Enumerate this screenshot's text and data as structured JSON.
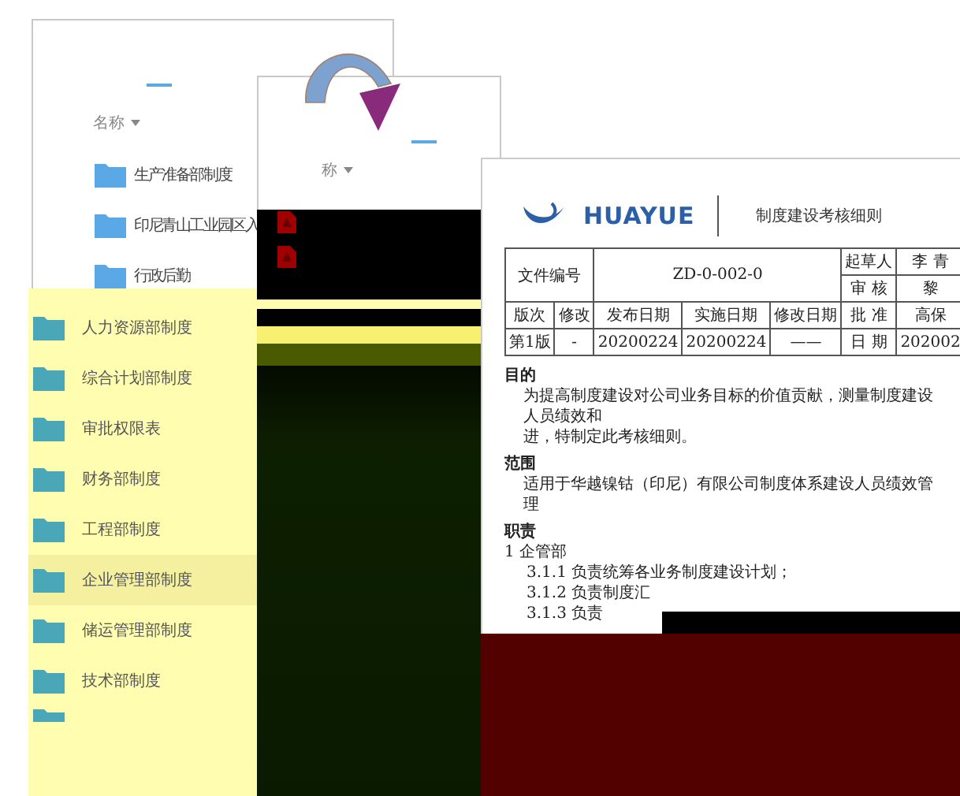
{
  "back_explorer": {
    "column_header": "名称",
    "items": [
      "生产准备部制度",
      "印尼青山工业园区入",
      "行政后勤"
    ]
  },
  "middle_explorer": {
    "column_header": "称"
  },
  "folder_panel": {
    "items": [
      {
        "name": "人力资源部制度",
        "selected": false
      },
      {
        "name": "综合计划部制度",
        "selected": false
      },
      {
        "name": "审批权限表",
        "selected": false
      },
      {
        "name": "财务部制度",
        "selected": false
      },
      {
        "name": "工程部制度",
        "selected": false
      },
      {
        "name": "企业管理部制度",
        "selected": true
      },
      {
        "name": "储运管理部制度",
        "selected": false
      },
      {
        "name": "技术部制度",
        "selected": false
      }
    ]
  },
  "document": {
    "logo": "HUAYUE",
    "title": "制度建设考核细则",
    "header_table": {
      "doc_no_label": "文件编号",
      "doc_no": "ZD-0-002-0",
      "drafter_label": "起草人",
      "drafter": "李 青",
      "reviewer_label": "审 核",
      "reviewer": "黎",
      "columns": [
        "版次",
        "修改",
        "发布日期",
        "实施日期",
        "修改日期"
      ],
      "approver_label": "批 准",
      "approver": "高保",
      "row": [
        "第1版",
        "-",
        "20200224",
        "20200224",
        "——"
      ],
      "date_label": "日 期",
      "date": "202002"
    },
    "sections": [
      {
        "kind": "heading",
        "text": "目的"
      },
      {
        "kind": "para",
        "text": "为提高制度建设对公司业务目标的价值贡献，测量制度建设人员绩效和"
      },
      {
        "kind": "para",
        "text": "进，特制定此考核细则。"
      },
      {
        "kind": "heading",
        "text": "范围"
      },
      {
        "kind": "para",
        "text": "适用于华越镍钴（印尼）有限公司制度体系建设人员绩效管理"
      },
      {
        "kind": "heading",
        "text": "职责"
      },
      {
        "kind": "plain",
        "text": "1 企管部"
      },
      {
        "kind": "item",
        "text": "3.1.1 负责统筹各业务制度建设计划；"
      },
      {
        "kind": "item",
        "text": "3.1.2 负责制度汇"
      },
      {
        "kind": "item",
        "text": "3.1.3 负责"
      }
    ]
  }
}
